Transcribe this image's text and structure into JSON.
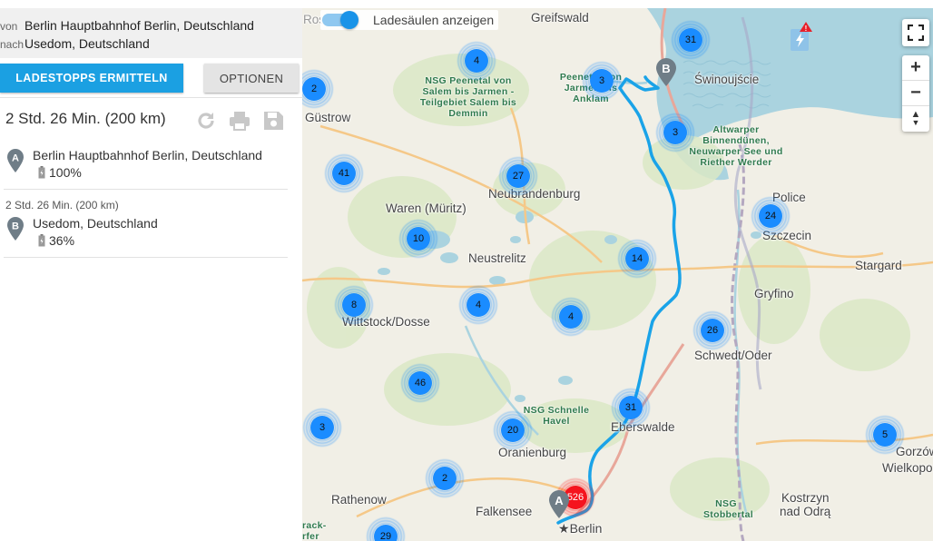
{
  "route": {
    "from_label": "von",
    "from_value": "Berlin Hauptbahnhof Berlin, Deutschland",
    "to_label": "nach",
    "to_value": "Usedom, Deutschland"
  },
  "buttons": {
    "ladestopps": "LADESTOPPS ERMITTELN",
    "optionen": "OPTIONEN"
  },
  "summary": "2 Std. 26 Min. (200 km)",
  "icons": [
    "refresh-icon",
    "print-icon",
    "save-icon"
  ],
  "stops": [
    {
      "marker": "A",
      "name": "Berlin Hauptbahnhof Berlin, Deutschland",
      "battery": "100%"
    },
    {
      "marker": "B",
      "name": "Usedom, Deutschland",
      "battery": "36%"
    }
  ],
  "leg_info": "2 Std. 26 Min. (200 km)",
  "map": {
    "toggle_label": "Ladesäulen anzeigen",
    "toggle_on": true,
    "zoom_in": "+",
    "zoom_out": "−",
    "north": "▲",
    "places": [
      "Greifswald",
      "Świnoujście",
      "Güstrow",
      "Neubrandenburg",
      "Waren (Müritz)",
      "Police",
      "Szczecin",
      "Neustrelitz",
      "Stargard",
      "Gryfino",
      "Wittstock/Dosse",
      "Schwedt/Oder",
      "Eberswalde",
      "Oranienburg",
      "Gorzów",
      "Wielkopo",
      "Rathenow",
      "Falkensee",
      "Berlin",
      "Kostrzyn",
      "nad Odrą",
      "Rost"
    ],
    "nsg": [
      "NSG Peenetal von Salem bis Jarmen - Teilgebiet Salem bis Demmin",
      "Peenetal von Jarmen bis Anklam",
      "Altwarper Binnendünen, Neuwarper See und Riether Werder",
      "NSG Schnelle Havel",
      "NSG Stobbertal",
      "rack-rfer"
    ],
    "clusters": [
      "31",
      "4",
      "3",
      "2",
      "3",
      "41",
      "27",
      "24",
      "10",
      "14",
      "8",
      "4",
      "4",
      "26",
      "46",
      "31",
      "3",
      "20",
      "5",
      "2",
      "526",
      "29"
    ]
  },
  "colors": {
    "accent": "#1ba0e2",
    "route": "#1aa3e8",
    "cluster": "#1a8cff",
    "cluster_hot": "#f5141e"
  }
}
